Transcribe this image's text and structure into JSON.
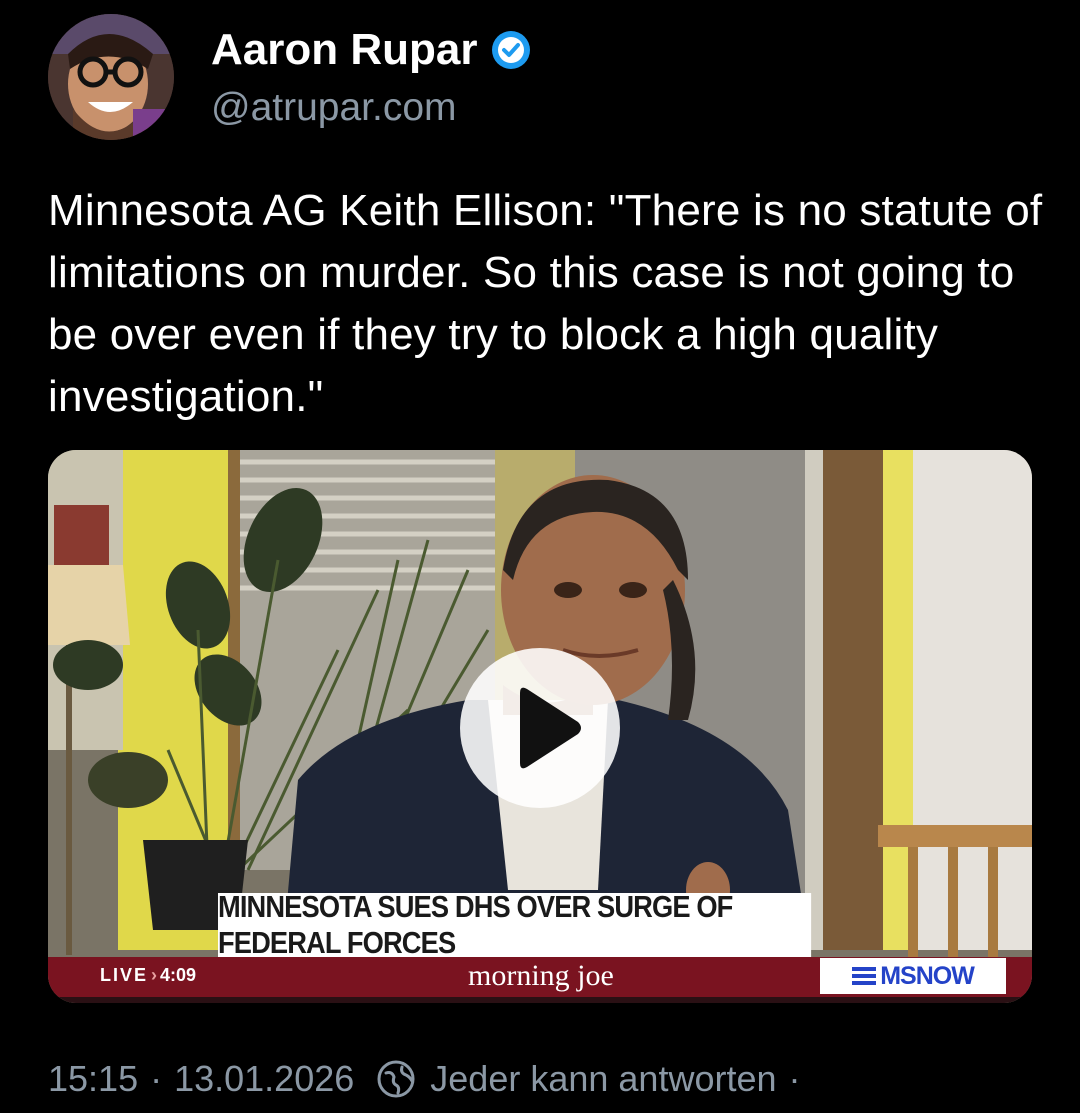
{
  "author": {
    "name": "Aaron Rupar",
    "handle": "@atrupar.com",
    "verified": true,
    "verified_color": "#1d9bf0"
  },
  "tweet": {
    "text": "Minnesota AG Keith Ellison: \"There is no statute of limitations on murder. So this case is not going to be over even if they try to block a high quality investigation.\""
  },
  "video": {
    "headline": "MINNESOTA SUES DHS OVER SURGE OF FEDERAL FORCES",
    "live_label": "LIVE",
    "live_time": "4:09",
    "show_name": "morning joe",
    "network": "MSNOW",
    "play_icon": "play-icon"
  },
  "footer": {
    "time": "15:15",
    "date": "13.01.2026",
    "reply_setting": "Jeder kann antworten",
    "reply_icon": "globe-icon"
  }
}
